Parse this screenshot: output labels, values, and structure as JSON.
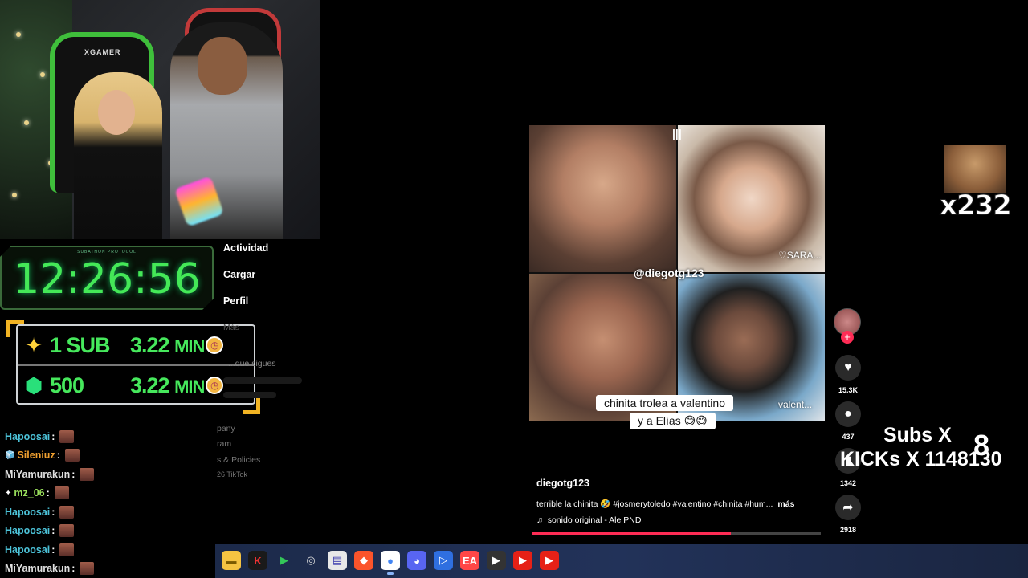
{
  "stream": {
    "webcam_brand": "XGAMER",
    "timer_tag": "SUBATHON PROTOCOL",
    "timer": "12:26:56",
    "goals": [
      {
        "count": "1 SUB",
        "time": "3.22",
        "unit": "MIN"
      },
      {
        "count": "500",
        "time": "3.22",
        "unit": "MIN"
      }
    ],
    "meme_count": "x232",
    "subs_label": "Subs X",
    "subs_value": "8",
    "kicks_label": "KICKs X 1148130"
  },
  "chat": [
    {
      "user": "Hapoosai",
      "color": "#4cc3d9",
      "badge": ""
    },
    {
      "user": "Sileniuz",
      "color": "#f0a030",
      "badge": "🧊"
    },
    {
      "user": "MiYamurakun",
      "color": "#e0e0e0",
      "badge": ""
    },
    {
      "user": "mz_06",
      "color": "#9be15d",
      "badge": "✦"
    },
    {
      "user": "Hapoosai",
      "color": "#4cc3d9",
      "badge": ""
    },
    {
      "user": "Hapoosai",
      "color": "#4cc3d9",
      "badge": ""
    },
    {
      "user": "Hapoosai",
      "color": "#4cc3d9",
      "badge": ""
    },
    {
      "user": "MiYamurakun",
      "color": "#e0e0e0",
      "badge": ""
    }
  ],
  "sidemenu": {
    "items": [
      "Actividad",
      "Cargar",
      "Perfil"
    ],
    "more": "Más",
    "following_hint": "...que sigues",
    "footer": [
      "pany",
      "ram",
      "s & Policies",
      "26 TikTok"
    ]
  },
  "video": {
    "handle_icon": "audio-bars-icon",
    "username_tag": "@diegotg123",
    "sara_label": "♡SARA...",
    "valent_label": "valent...",
    "caption_line1": "chinita trolea a valentino",
    "caption_line2": "y a Elías 😅😅",
    "author": "diegotg123",
    "description": "terrible la chinita 🤣 #josmerytoledo #valentino #chinita #hum...",
    "more": "más",
    "sound": "sonido original - Ale PND",
    "progress": 0.69
  },
  "actions": {
    "likes": "15.3K",
    "comments": "437",
    "saves": "1342",
    "shares": "2918"
  },
  "colors": {
    "timer_green": "#44e857",
    "tiktok_red": "#fe2c55",
    "goal_border": "#cfd3d6"
  },
  "taskbar": [
    {
      "name": "file-explorer-icon",
      "glyph": "▬",
      "bg": "#f5c342",
      "fg": "#7a5a00"
    },
    {
      "name": "app-k-icon",
      "glyph": "K",
      "bg": "#1a1a1a",
      "fg": "#e33"
    },
    {
      "name": "play-store-icon",
      "glyph": "▶",
      "bg": "transparent",
      "fg": "#34c759"
    },
    {
      "name": "obs-icon",
      "glyph": "◎",
      "bg": "transparent",
      "fg": "#ddd"
    },
    {
      "name": "notepad-icon",
      "glyph": "▤",
      "bg": "#e8e8e8",
      "fg": "#33a"
    },
    {
      "name": "brave-icon",
      "glyph": "◆",
      "bg": "#fb542b",
      "fg": "#fff"
    },
    {
      "name": "chrome-icon",
      "glyph": "●",
      "bg": "#ffffff",
      "fg": "#4285f4"
    },
    {
      "name": "discord-icon",
      "glyph": "◕",
      "bg": "#5865f2",
      "fg": "#fff"
    },
    {
      "name": "remote-play-icon",
      "glyph": "▷",
      "bg": "#2f6fe0",
      "fg": "#fff"
    },
    {
      "name": "ea-icon",
      "glyph": "EA",
      "bg": "#ff4747",
      "fg": "#fff"
    },
    {
      "name": "media-player-icon",
      "glyph": "▶",
      "bg": "#333",
      "fg": "#fff"
    },
    {
      "name": "youtube-icon",
      "glyph": "▶",
      "bg": "#e62117",
      "fg": "#fff"
    },
    {
      "name": "youtube-studio-icon",
      "glyph": "▶",
      "bg": "#e62117",
      "fg": "#fff"
    }
  ]
}
